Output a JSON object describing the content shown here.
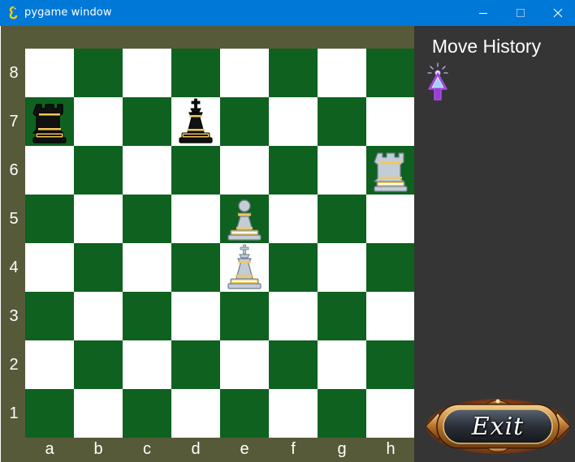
{
  "window": {
    "title": "pygame window"
  },
  "colors": {
    "light_square": "#ffffff",
    "dark_square": "#0f6120",
    "frame": "#565a39",
    "panel": "#353535",
    "titlebar": "#0078d7"
  },
  "board": {
    "files": [
      "a",
      "b",
      "c",
      "d",
      "e",
      "f",
      "g",
      "h"
    ],
    "ranks": [
      "8",
      "7",
      "6",
      "5",
      "4",
      "3",
      "2",
      "1"
    ],
    "pieces": [
      {
        "square": "a7",
        "color": "black",
        "type": "rook"
      },
      {
        "square": "d7",
        "color": "black",
        "type": "king"
      },
      {
        "square": "h6",
        "color": "white",
        "type": "rook"
      },
      {
        "square": "e5",
        "color": "white",
        "type": "pawn"
      },
      {
        "square": "e4",
        "color": "white",
        "type": "king"
      }
    ]
  },
  "history": {
    "title": "Move History",
    "cursor_icon": "cursor-pointer-icon"
  },
  "exit": {
    "label": "Exit"
  }
}
